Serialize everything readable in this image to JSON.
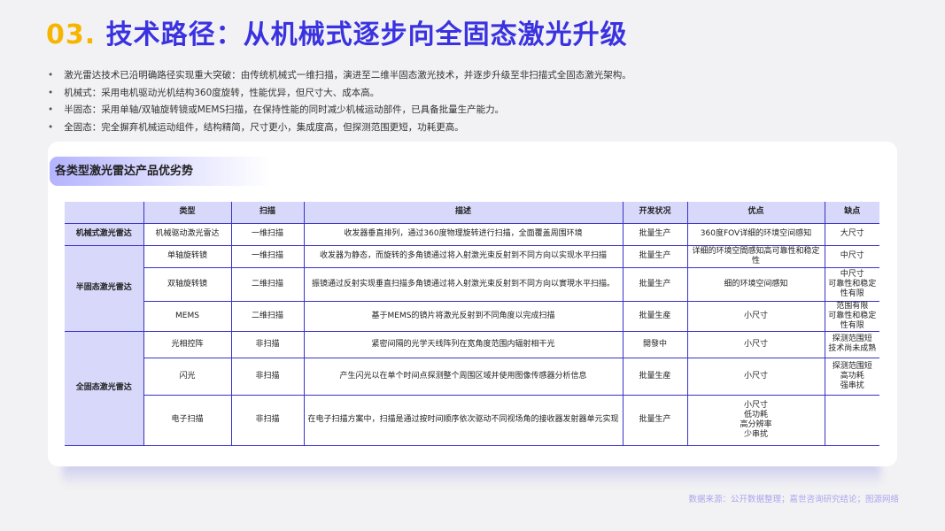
{
  "header": {
    "number": "03.",
    "title": "技术路径：从机械式逐步向全固态激光升级"
  },
  "bullets": [
    "激光雷达技术已沿明确路径实现重大突破：由传统机械式一维扫描，演进至二维半固态激光技术，并逐步升级至非扫描式全固态激光架构。",
    "机械式：采用电机驱动光机结构360度旋转，性能优异，但尺寸大、成本高。",
    "半固态：采用单轴/双轴旋转镜或MEMS扫描，在保持性能的同时减少机械运动部件，已具备批量生产能力。",
    "全固态：完全摒弃机械运动组件，结构精简，尺寸更小，集成度高，但探测范围更短，功耗更高。"
  ],
  "section_title": "各类型激光雷达产品优劣势",
  "table": {
    "headers": [
      "",
      "类型",
      "扫描",
      "描述",
      "开发状况",
      "优点",
      "缺点"
    ],
    "groups": [
      "机械式激光雷达",
      "半固态激光雷达",
      "全固态激光雷达"
    ],
    "rows": [
      [
        "机械驱动激光雷达",
        "一维扫描",
        "收发器垂直排列，通过360度物理旋转进行扫描，全面覆盖周围环境",
        "批量生产",
        "360度FOV详细的环境空间感知",
        "大尺寸"
      ],
      [
        "单轴旋转镜",
        "一维扫描",
        "收发器为静态，而旋转的多角镜通过将入射激光束反射到不同方向以实现水平扫描",
        "批量生产",
        "详细的环境空間感知高可靠性和稳定性",
        "中尺寸"
      ],
      [
        "双轴旋转镜",
        "二维扫描",
        "振镜通过反射实现垂直扫描多角镜通过将入射激光束反射到不同方向以實現水平扫描。",
        "批量生产",
        "细的环境空间感知",
        "中尺寸\n可靠性和稳定性有限"
      ],
      [
        "MEMS",
        "二维扫描",
        "基于MEMS的镜片将激光反射到不同角度以完成扫描",
        "批量生産",
        "小尺寸",
        "范围有限\n可靠性和稳定性有限"
      ],
      [
        "光相控阵",
        "非扫描",
        "紧密间隔的光学天线阵列在宽角度范围内辐射相干光",
        "開發中",
        "小尺寸",
        "探测范围短\n技术尚未成熟"
      ],
      [
        "闪光",
        "非扫描",
        "产生闪光以在单个时间点探测整个周围区域并使用图像传感器分析信息",
        "批量生産",
        "小尺寸",
        "探测范围短\n高功耗\n强串扰"
      ],
      [
        "电子扫描",
        "非扫描",
        "在电子扫描方案中，扫描是通过按时间顺序依次驱动不同视场角的接收器发射器单元实现",
        "批量生产",
        "小尺寸\n低功耗\n高分辨率\n少串扰",
        ""
      ]
    ]
  },
  "source": "数据来源：公开数据整理；嘉世咨询研究结论；图源网络"
}
